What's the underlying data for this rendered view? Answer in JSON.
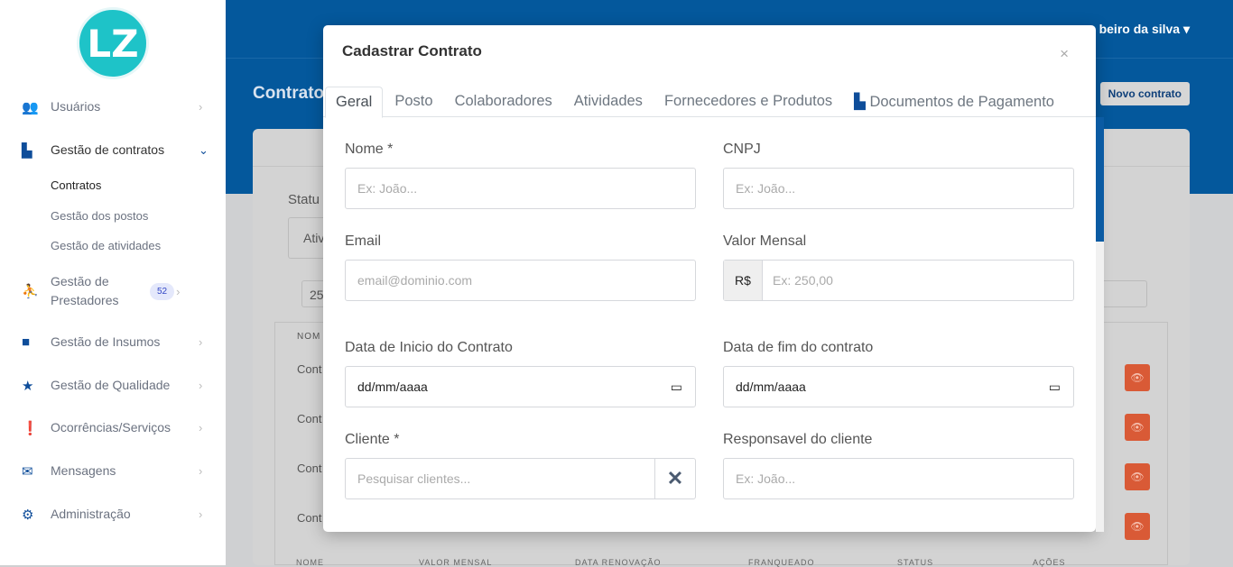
{
  "sidebar": {
    "logo": "LZ",
    "items": [
      {
        "label": "Usuários",
        "icon": "users-icon"
      },
      {
        "label": "Gestão de contratos",
        "icon": "contract-file-icon"
      },
      {
        "label": "Gestão de Prestadores",
        "icon": "people-carry-icon",
        "badge": "52"
      },
      {
        "label": "Gestão de Insumos",
        "icon": "box-icon"
      },
      {
        "label": "Gestão de Qualidade",
        "icon": "star-icon"
      },
      {
        "label": "Ocorrências/Serviços",
        "icon": "exclamation-circle-icon"
      },
      {
        "label": "Mensagens",
        "icon": "envelope-icon"
      },
      {
        "label": "Administração",
        "icon": "gear-icon"
      }
    ],
    "subitems": [
      "Contratos",
      "Gestão dos postos",
      "Gestão de atividades"
    ]
  },
  "header": {
    "user": "beiro da silva",
    "page_title": "Contrato",
    "new_button": "Novo contrato"
  },
  "background": {
    "status_label": "Statu",
    "status_value": "Ativ",
    "page_size": "25",
    "col_nome": "NOM",
    "row_text": "Cont",
    "footer_cols": [
      "NOME",
      "VALOR MENSAL",
      "DATA RENOVAÇÃO",
      "FRANQUEADO",
      "STATUS",
      "AÇÕES"
    ]
  },
  "modal": {
    "title": "Cadastrar Contrato",
    "close": "×",
    "tabs": [
      "Geral",
      "Posto",
      "Colaboradores",
      "Atividades",
      "Fornecedores e Produtos",
      "Documentos de Pagamento"
    ],
    "fields": {
      "nome": {
        "label": "Nome *",
        "placeholder": "Ex: João..."
      },
      "cnpj": {
        "label": "CNPJ",
        "placeholder": "Ex: João..."
      },
      "email": {
        "label": "Email",
        "placeholder": "email@dominio.com"
      },
      "valor": {
        "label": "Valor Mensal",
        "prefix": "R$",
        "placeholder": "Ex: 250,00"
      },
      "inicio": {
        "label": "Data de Inicio do Contrato",
        "value": "dd/mm/aaaa"
      },
      "fim": {
        "label": "Data de fim do contrato",
        "value": "dd/mm/aaaa"
      },
      "cliente": {
        "label": "Cliente *",
        "placeholder": "Pesquisar clientes..."
      },
      "responsavel": {
        "label": "Responsavel do cliente",
        "placeholder": "Ex: João..."
      }
    }
  }
}
